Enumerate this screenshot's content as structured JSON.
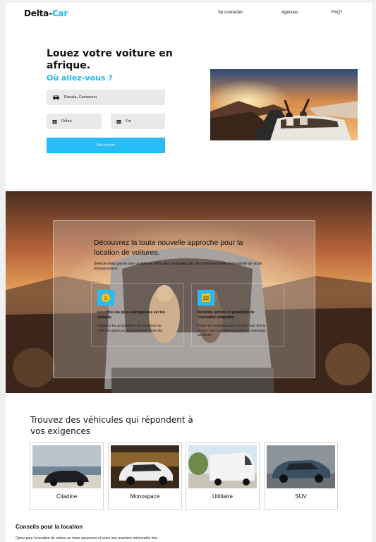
{
  "header": {
    "logo_part1": "Delta-",
    "logo_part2": "Car",
    "nav": [
      "Se connecter",
      "Agences",
      "FAQ?"
    ]
  },
  "hero": {
    "title": "Louez votre voiture en afrique.",
    "subtitle": "Où allez-vous ?",
    "location_value": "Douala, Cameroun",
    "start_label": "Début",
    "end_label": "Fin",
    "search_label": "Recherche"
  },
  "banner": {
    "title": "Découvrez la toute nouvelle approche pour la location de voitures.",
    "description": "Sélectionnez parmi une variété de véhicules proposés par des professionnels à proximité de votre emplacement.",
    "features": [
      {
        "title": "Les offres les plus avantageuses sur les voitures.",
        "text": "Explorez les propositions de locations de diverses agences dans plusieurs endroits."
      },
      {
        "title": "flexibilité tarifaire et possibilité de réservation adaptable.",
        "text": "Évitez les surprises avec un prix clair dès le départ, une annulation gratuite et nettoyage amélioré."
      }
    ]
  },
  "categories": {
    "title": "Trouvez des véhicules qui répondent à vos exigences",
    "items": [
      {
        "label": "Citadine"
      },
      {
        "label": "Monospace"
      },
      {
        "label": "Utilitaire"
      },
      {
        "label": "SUV"
      }
    ]
  },
  "tips": {
    "title": "Conseils pour la location",
    "text": "Optez pour la location de voiture en toute assurance et vivez une aventure mémorable lors."
  },
  "colors": {
    "accent": "#27bcf5",
    "field_bg": "#e9e9e9"
  }
}
